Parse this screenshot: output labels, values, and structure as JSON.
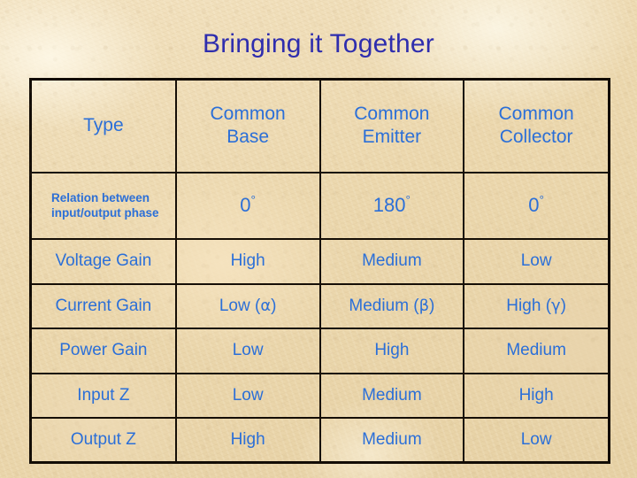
{
  "slide": {
    "title": "Bringing it Together",
    "title_color": "#2e2dae",
    "text_color": "#2b6fd8",
    "background": "#ecd9b0",
    "border_color": "#150e06"
  },
  "table": {
    "headers": [
      "Type",
      "Common Base",
      "Common Emitter",
      "Common Collector"
    ],
    "rows": [
      {
        "label": "Relation between input/output phase",
        "cells": [
          "0°",
          "180°",
          "0°"
        ]
      },
      {
        "label": "Voltage Gain",
        "cells": [
          "High",
          "Medium",
          "Low"
        ]
      },
      {
        "label": "Current Gain",
        "cells": [
          "Low (α)",
          "Medium (β)",
          "High (γ)"
        ]
      },
      {
        "label": "Power Gain",
        "cells": [
          "Low",
          "High",
          "Medium"
        ]
      },
      {
        "label": "Input Z",
        "cells": [
          "Low",
          "Medium",
          "High"
        ]
      },
      {
        "label": "Output Z",
        "cells": [
          "High",
          "Medium",
          "Low"
        ]
      }
    ]
  }
}
